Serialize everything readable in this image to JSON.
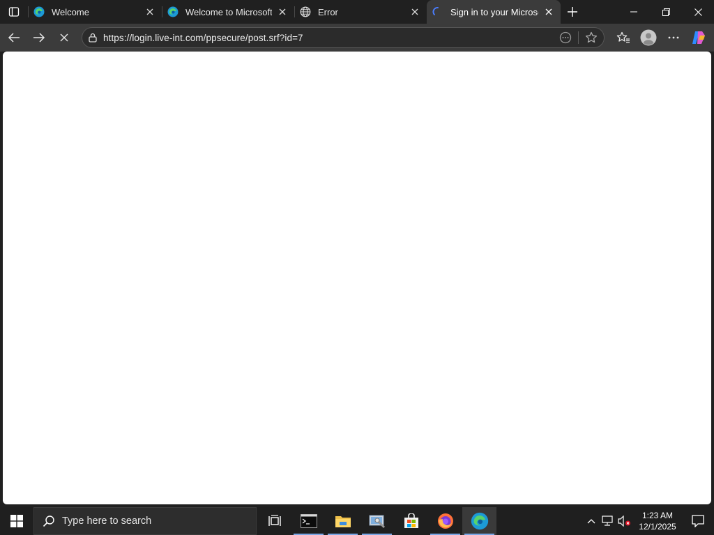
{
  "tabs": [
    {
      "title": "Welcome",
      "icon": "edge-icon"
    },
    {
      "title": "Welcome to Microsoft Edge",
      "icon": "edge-icon"
    },
    {
      "title": "Error",
      "icon": "globe-icon"
    },
    {
      "title": "Sign in to your Microsoft account",
      "icon": "loading-spinner-icon",
      "active": true
    }
  ],
  "address_bar": {
    "url": "https://login.live-int.com/ppsecure/post.srf?id=7"
  },
  "taskbar": {
    "search_placeholder": "Type here to search",
    "apps": [
      "task-view",
      "terminal",
      "file-explorer",
      "control-panel",
      "microsoft-store",
      "firefox",
      "edge"
    ],
    "clock_time": "1:23 AM",
    "clock_date": "12/1/2025"
  },
  "colors": {
    "titlebar": "#202020",
    "toolbar": "#3b3b3b",
    "page": "#ffffff",
    "taskbar": "#1f1f1f"
  }
}
